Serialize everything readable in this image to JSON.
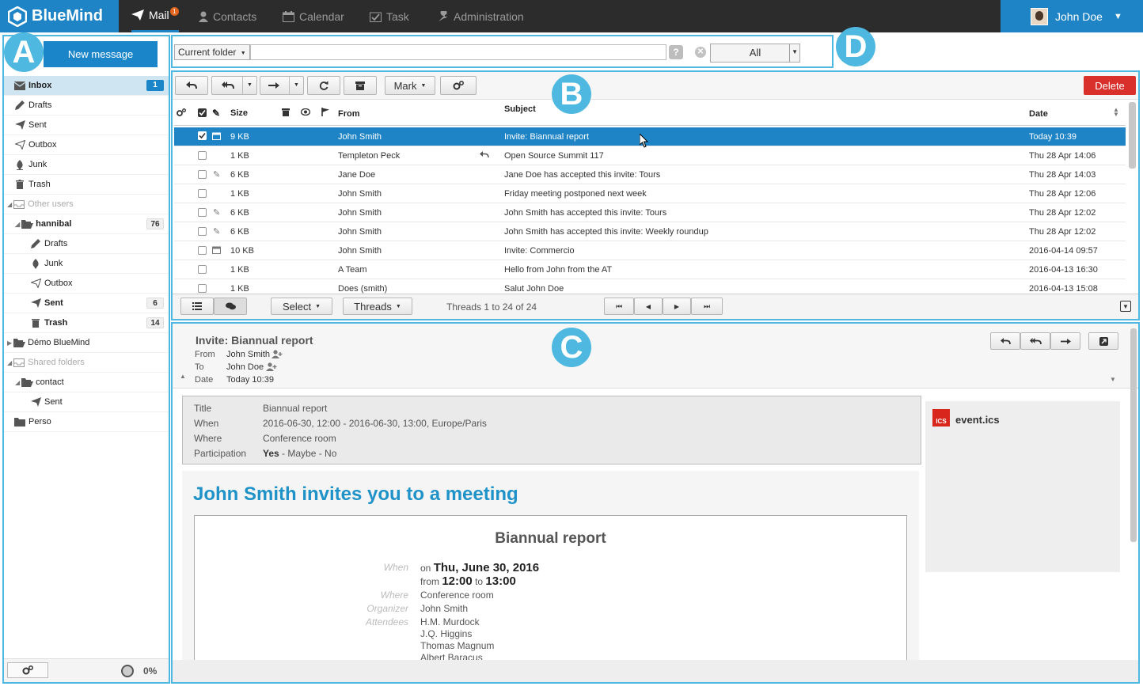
{
  "app": {
    "brand": "BlueMind",
    "nav": [
      {
        "label": "Mail",
        "badge": "1"
      },
      {
        "label": "Contacts"
      },
      {
        "label": "Calendar"
      },
      {
        "label": "Task"
      },
      {
        "label": "Administration"
      }
    ],
    "user": "John Doe",
    "accent": "#1f84c6"
  },
  "annotations": {
    "a": "A",
    "b": "B",
    "c": "C",
    "d": "D"
  },
  "sidebar": {
    "new_message": "New message",
    "folders": [
      {
        "label": "Inbox",
        "count": "1",
        "icon": "inbox-icon"
      },
      {
        "label": "Drafts",
        "icon": "pencil-icon"
      },
      {
        "label": "Sent",
        "icon": "send-icon"
      },
      {
        "label": "Outbox",
        "icon": "outbox-icon"
      },
      {
        "label": "Junk",
        "icon": "junk-icon"
      },
      {
        "label": "Trash",
        "icon": "trash-icon"
      },
      {
        "label": "Other users",
        "icon": "inbox-icon"
      },
      {
        "label": "hannibal",
        "count": "76",
        "icon": "folder-open-icon"
      },
      {
        "label": "Drafts",
        "icon": "pencil-icon"
      },
      {
        "label": "Junk",
        "icon": "junk-icon"
      },
      {
        "label": "Outbox",
        "icon": "outbox-icon"
      },
      {
        "label": "Sent",
        "count": "6",
        "icon": "send-icon"
      },
      {
        "label": "Trash",
        "count": "14",
        "icon": "trash-icon"
      },
      {
        "label": "Démo BlueMind",
        "icon": "folder-icon"
      },
      {
        "label": "Shared folders",
        "icon": "inbox-icon"
      },
      {
        "label": "contact",
        "icon": "folder-open-icon"
      },
      {
        "label": "Sent",
        "icon": "send-icon"
      },
      {
        "label": "Perso",
        "icon": "folder-icon"
      }
    ],
    "quota": "0%"
  },
  "search": {
    "scope": "Current folder",
    "help": "?",
    "filter": "All"
  },
  "list": {
    "toolbar": {
      "mark": "Mark",
      "delete": "Delete"
    },
    "columns": {
      "size": "Size",
      "from": "From",
      "subject": "Subject",
      "date": "Date"
    },
    "rows": [
      {
        "size": "9 KB",
        "from": "John Smith",
        "subject": "Invite: Biannual report",
        "date": "Today 10:39"
      },
      {
        "size": "1 KB",
        "from": "Templeton Peck",
        "subject": "Open Source Summit 117",
        "date": "Thu 28 Apr 14:06"
      },
      {
        "size": "6 KB",
        "from": "Jane Doe",
        "subject": "Jane Doe has accepted this invite: Tours",
        "date": "Thu 28 Apr 14:03"
      },
      {
        "size": "1 KB",
        "from": "John Smith",
        "subject": "Friday meeting postponed next week",
        "date": "Thu 28 Apr 12:06"
      },
      {
        "size": "6 KB",
        "from": "John Smith",
        "subject": "John Smith has accepted this invite: Tours",
        "date": "Thu 28 Apr 12:02"
      },
      {
        "size": "6 KB",
        "from": "John Smith",
        "subject": "John Smith has accepted this invite: Weekly roundup",
        "date": "Thu 28 Apr 12:02"
      },
      {
        "size": "10 KB",
        "from": "John Smith",
        "subject": "Invite: Commercio",
        "date": "2016-04-14 09:57"
      },
      {
        "size": "1 KB",
        "from": "A Team",
        "subject": "Hello from John from the AT",
        "date": "2016-04-13 16:30"
      },
      {
        "size": "1 KB",
        "from": "Does (smith)",
        "subject": "Salut John Doe",
        "date": "2016-04-13 15:08"
      }
    ],
    "footer": {
      "select": "Select",
      "threads": "Threads",
      "range": "Threads 1 to 24 of 24"
    }
  },
  "preview": {
    "subject": "Invite: Biannual report",
    "from_label": "From",
    "from": "John Smith",
    "to_label": "To",
    "to": "John Doe",
    "date_label": "Date",
    "date": "Today 10:39",
    "invite": {
      "title_label": "Title",
      "title": "Biannual report",
      "when_label": "When",
      "when": "2016-06-30, 12:00 - 2016-06-30, 13:00, Europe/Paris",
      "where_label": "Where",
      "where": "Conference room",
      "participation_label": "Participation",
      "yes": "Yes",
      "rest": " - Maybe - No"
    },
    "attachment": "event.ics",
    "attachment_tag": "ICS",
    "body": {
      "headline": "John Smith invites you to a meeting",
      "meeting": "Biannual report",
      "when_label": "When",
      "on": "on",
      "day": "Thu, June 30, 2016",
      "from_word": "from",
      "start": "12:00",
      "to_word": "to",
      "end": "13:00",
      "where_label": "Where",
      "where": "Conference room",
      "organizer_label": "Organizer",
      "organizer": "John Smith",
      "attendees_label": "Attendees",
      "attendees": [
        "H.M. Murdock",
        "J.Q. Higgins",
        "Thomas Magnum",
        "Albert Baracus"
      ]
    }
  }
}
